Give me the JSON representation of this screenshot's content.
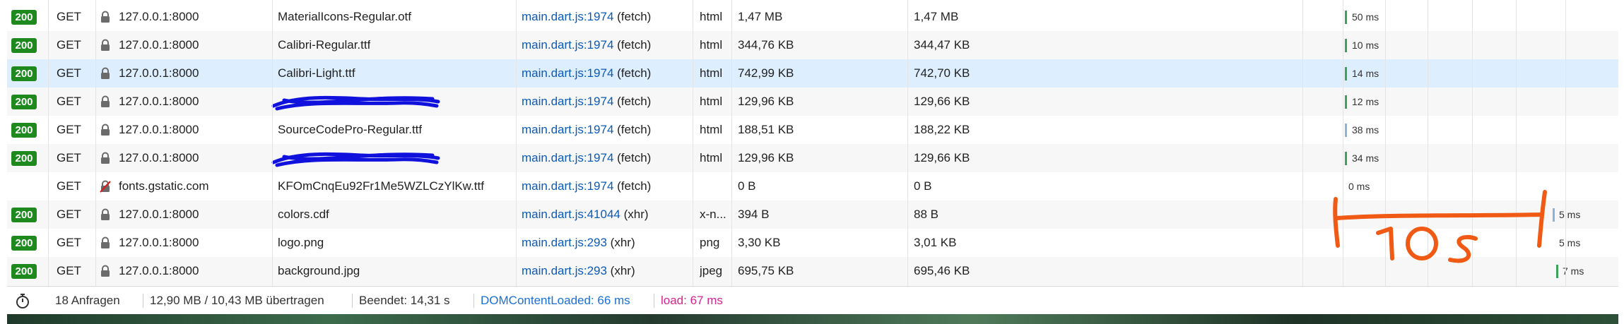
{
  "requests": [
    {
      "status": "200",
      "method": "GET",
      "secure": true,
      "host": "127.0.0.1:8000",
      "file": "MaterialIcons-Regular.otf",
      "initiator_link": "main.dart.js:1974",
      "initiator_suffix": " (fetch)",
      "type": "html",
      "transferred": "1,47 MB",
      "size": "1,47 MB",
      "timing": "50 ms",
      "bar_color": "#3aa55a"
    },
    {
      "status": "200",
      "method": "GET",
      "secure": true,
      "host": "127.0.0.1:8000",
      "file": "Calibri-Regular.ttf",
      "initiator_link": "main.dart.js:1974",
      "initiator_suffix": " (fetch)",
      "type": "html",
      "transferred": "344,76 KB",
      "size": "344,47 KB",
      "timing": "10 ms",
      "bar_color": "#3aa55a"
    },
    {
      "status": "200",
      "method": "GET",
      "secure": true,
      "host": "127.0.0.1:8000",
      "file": "Calibri-Light.ttf",
      "initiator_link": "main.dart.js:1974",
      "initiator_suffix": " (fetch)",
      "type": "html",
      "transferred": "742,99 KB",
      "size": "742,70 KB",
      "timing": "14 ms",
      "bar_color": "#3aa55a"
    },
    {
      "status": "200",
      "method": "GET",
      "secure": true,
      "host": "127.0.0.1:8000",
      "file": "",
      "initiator_link": "main.dart.js:1974",
      "initiator_suffix": " (fetch)",
      "type": "html",
      "transferred": "129,96 KB",
      "size": "129,66 KB",
      "timing": "12 ms",
      "bar_color": "#3aa55a"
    },
    {
      "status": "200",
      "method": "GET",
      "secure": true,
      "host": "127.0.0.1:8000",
      "file": "SourceCodePro-Regular.ttf",
      "initiator_link": "main.dart.js:1974",
      "initiator_suffix": " (fetch)",
      "type": "html",
      "transferred": "188,51 KB",
      "size": "188,22 KB",
      "timing": "38 ms",
      "bar_color": "#8ab4d8"
    },
    {
      "status": "200",
      "method": "GET",
      "secure": true,
      "host": "127.0.0.1:8000",
      "file": "",
      "initiator_link": "main.dart.js:1974",
      "initiator_suffix": " (fetch)",
      "type": "html",
      "transferred": "129,96 KB",
      "size": "129,66 KB",
      "timing": "34 ms",
      "bar_color": "#3aa55a"
    },
    {
      "status": "",
      "method": "GET",
      "secure": false,
      "host": "fonts.gstatic.com",
      "file": "KFOmCnqEu92Fr1Me5WZLCzYlKw.ttf",
      "initiator_link": "main.dart.js:1974",
      "initiator_suffix": " (fetch)",
      "type": "",
      "transferred": "0 B",
      "size": "0 B",
      "timing": "0 ms",
      "bar_color": ""
    },
    {
      "status": "200",
      "method": "GET",
      "secure": true,
      "host": "127.0.0.1:8000",
      "file": "colors.cdf",
      "initiator_link": "main.dart.js:41044",
      "initiator_suffix": " (xhr)",
      "type": "x-n...",
      "transferred": "394 B",
      "size": "88 B",
      "timing": "5 ms",
      "bar_color": "#8ab4d8"
    },
    {
      "status": "200",
      "method": "GET",
      "secure": true,
      "host": "127.0.0.1:8000",
      "file": "logo.png",
      "initiator_link": "main.dart.js:293",
      "initiator_suffix": " (xhr)",
      "type": "png",
      "transferred": "3,30 KB",
      "size": "3,01 KB",
      "timing": "5 ms",
      "bar_color": ""
    },
    {
      "status": "200",
      "method": "GET",
      "secure": true,
      "host": "127.0.0.1:8000",
      "file": "background.jpg",
      "initiator_link": "main.dart.js:293",
      "initiator_suffix": " (xhr)",
      "type": "jpeg",
      "transferred": "695,75 KB",
      "size": "695,46 KB",
      "timing": "7 ms",
      "bar_color": "#3aa55a"
    }
  ],
  "statusbar": {
    "requests": "18 Anfragen",
    "transferred": "12,90 MB / 10,43 MB übertragen",
    "finished": "Beendet: 14,31 s",
    "domcontentloaded": "DOMContentLoaded: 66 ms",
    "load": "load: 67 ms"
  },
  "annotation": {
    "label": "10s",
    "color": "#f05a14"
  },
  "colors": {
    "status_ok": "#1e8a1e",
    "link": "#0a5ab8",
    "domcontentloaded": "#1a6fd6",
    "load": "#d8228d",
    "selected_row": "#ddeeff"
  }
}
